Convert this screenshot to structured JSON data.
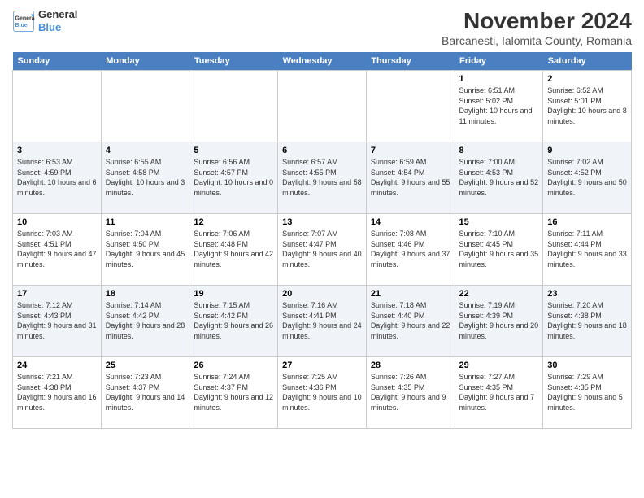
{
  "logo": {
    "line1": "General",
    "line2": "Blue"
  },
  "title": "November 2024",
  "subtitle": "Barcanesti, Ialomita County, Romania",
  "headers": [
    "Sunday",
    "Monday",
    "Tuesday",
    "Wednesday",
    "Thursday",
    "Friday",
    "Saturday"
  ],
  "weeks": [
    [
      {
        "day": "",
        "info": ""
      },
      {
        "day": "",
        "info": ""
      },
      {
        "day": "",
        "info": ""
      },
      {
        "day": "",
        "info": ""
      },
      {
        "day": "",
        "info": ""
      },
      {
        "day": "1",
        "info": "Sunrise: 6:51 AM\nSunset: 5:02 PM\nDaylight: 10 hours and 11 minutes."
      },
      {
        "day": "2",
        "info": "Sunrise: 6:52 AM\nSunset: 5:01 PM\nDaylight: 10 hours and 8 minutes."
      }
    ],
    [
      {
        "day": "3",
        "info": "Sunrise: 6:53 AM\nSunset: 4:59 PM\nDaylight: 10 hours and 6 minutes."
      },
      {
        "day": "4",
        "info": "Sunrise: 6:55 AM\nSunset: 4:58 PM\nDaylight: 10 hours and 3 minutes."
      },
      {
        "day": "5",
        "info": "Sunrise: 6:56 AM\nSunset: 4:57 PM\nDaylight: 10 hours and 0 minutes."
      },
      {
        "day": "6",
        "info": "Sunrise: 6:57 AM\nSunset: 4:55 PM\nDaylight: 9 hours and 58 minutes."
      },
      {
        "day": "7",
        "info": "Sunrise: 6:59 AM\nSunset: 4:54 PM\nDaylight: 9 hours and 55 minutes."
      },
      {
        "day": "8",
        "info": "Sunrise: 7:00 AM\nSunset: 4:53 PM\nDaylight: 9 hours and 52 minutes."
      },
      {
        "day": "9",
        "info": "Sunrise: 7:02 AM\nSunset: 4:52 PM\nDaylight: 9 hours and 50 minutes."
      }
    ],
    [
      {
        "day": "10",
        "info": "Sunrise: 7:03 AM\nSunset: 4:51 PM\nDaylight: 9 hours and 47 minutes."
      },
      {
        "day": "11",
        "info": "Sunrise: 7:04 AM\nSunset: 4:50 PM\nDaylight: 9 hours and 45 minutes."
      },
      {
        "day": "12",
        "info": "Sunrise: 7:06 AM\nSunset: 4:48 PM\nDaylight: 9 hours and 42 minutes."
      },
      {
        "day": "13",
        "info": "Sunrise: 7:07 AM\nSunset: 4:47 PM\nDaylight: 9 hours and 40 minutes."
      },
      {
        "day": "14",
        "info": "Sunrise: 7:08 AM\nSunset: 4:46 PM\nDaylight: 9 hours and 37 minutes."
      },
      {
        "day": "15",
        "info": "Sunrise: 7:10 AM\nSunset: 4:45 PM\nDaylight: 9 hours and 35 minutes."
      },
      {
        "day": "16",
        "info": "Sunrise: 7:11 AM\nSunset: 4:44 PM\nDaylight: 9 hours and 33 minutes."
      }
    ],
    [
      {
        "day": "17",
        "info": "Sunrise: 7:12 AM\nSunset: 4:43 PM\nDaylight: 9 hours and 31 minutes."
      },
      {
        "day": "18",
        "info": "Sunrise: 7:14 AM\nSunset: 4:42 PM\nDaylight: 9 hours and 28 minutes."
      },
      {
        "day": "19",
        "info": "Sunrise: 7:15 AM\nSunset: 4:42 PM\nDaylight: 9 hours and 26 minutes."
      },
      {
        "day": "20",
        "info": "Sunrise: 7:16 AM\nSunset: 4:41 PM\nDaylight: 9 hours and 24 minutes."
      },
      {
        "day": "21",
        "info": "Sunrise: 7:18 AM\nSunset: 4:40 PM\nDaylight: 9 hours and 22 minutes."
      },
      {
        "day": "22",
        "info": "Sunrise: 7:19 AM\nSunset: 4:39 PM\nDaylight: 9 hours and 20 minutes."
      },
      {
        "day": "23",
        "info": "Sunrise: 7:20 AM\nSunset: 4:38 PM\nDaylight: 9 hours and 18 minutes."
      }
    ],
    [
      {
        "day": "24",
        "info": "Sunrise: 7:21 AM\nSunset: 4:38 PM\nDaylight: 9 hours and 16 minutes."
      },
      {
        "day": "25",
        "info": "Sunrise: 7:23 AM\nSunset: 4:37 PM\nDaylight: 9 hours and 14 minutes."
      },
      {
        "day": "26",
        "info": "Sunrise: 7:24 AM\nSunset: 4:37 PM\nDaylight: 9 hours and 12 minutes."
      },
      {
        "day": "27",
        "info": "Sunrise: 7:25 AM\nSunset: 4:36 PM\nDaylight: 9 hours and 10 minutes."
      },
      {
        "day": "28",
        "info": "Sunrise: 7:26 AM\nSunset: 4:35 PM\nDaylight: 9 hours and 9 minutes."
      },
      {
        "day": "29",
        "info": "Sunrise: 7:27 AM\nSunset: 4:35 PM\nDaylight: 9 hours and 7 minutes."
      },
      {
        "day": "30",
        "info": "Sunrise: 7:29 AM\nSunset: 4:35 PM\nDaylight: 9 hours and 5 minutes."
      }
    ]
  ]
}
